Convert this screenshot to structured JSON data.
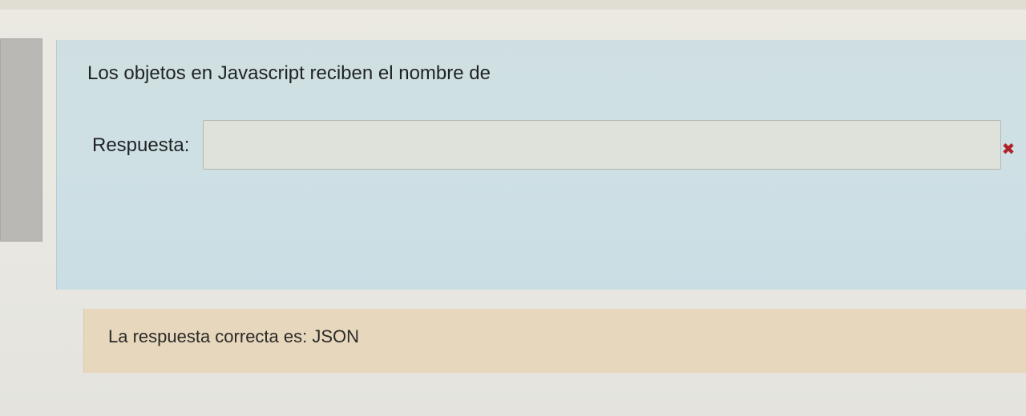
{
  "question": {
    "text": "Los objetos en Javascript reciben el nombre de",
    "answer_label": "Respuesta:",
    "answer_value": "",
    "status_icon": "close-icon",
    "status_color": "#b0222a"
  },
  "feedback": {
    "right_answer": "La respuesta correcta es: JSON"
  },
  "colors": {
    "content_bg": "#cfe0e4",
    "feedback_bg": "#e7d7bd",
    "info_bg": "#b9b8b5"
  }
}
